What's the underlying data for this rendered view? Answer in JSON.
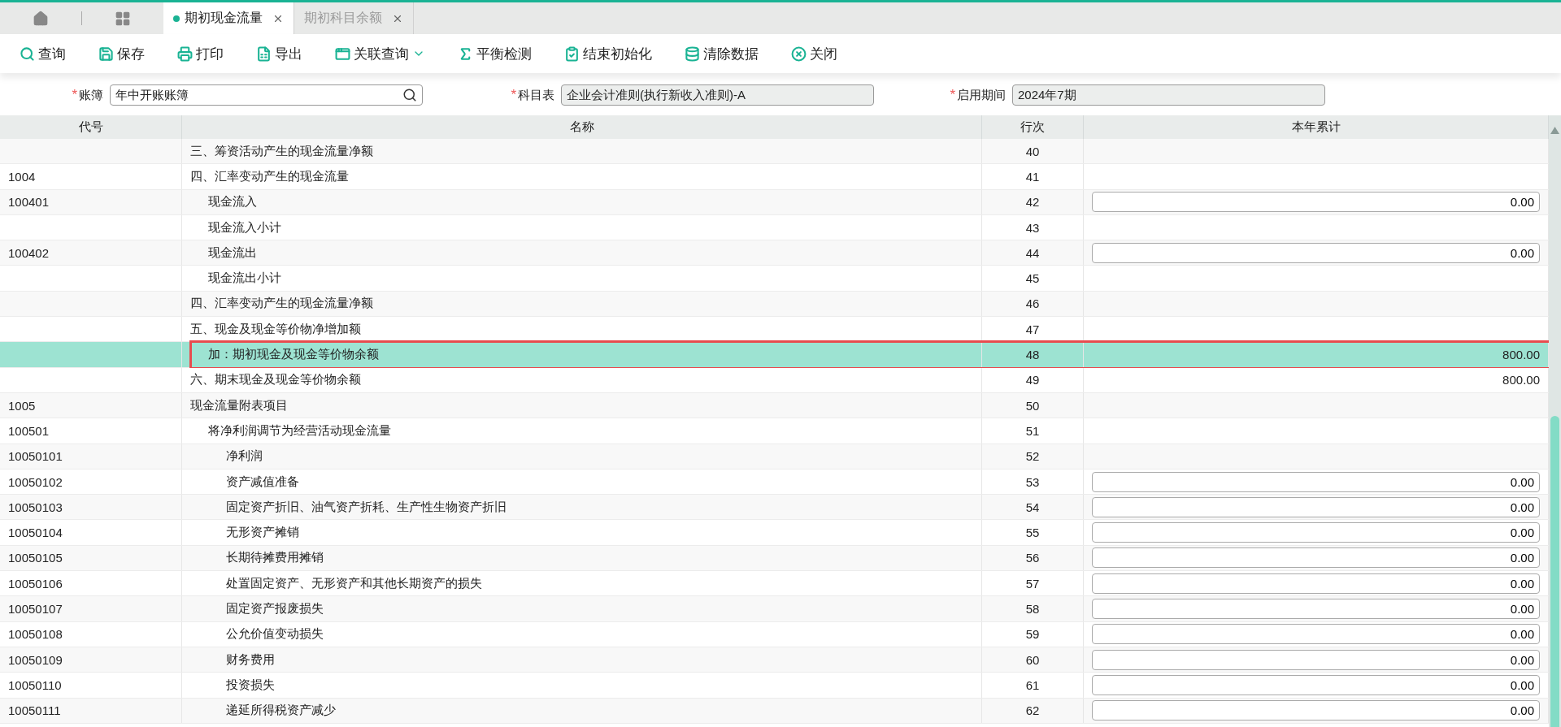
{
  "tabs": [
    {
      "label": "期初现金流量",
      "selected": true
    },
    {
      "label": "期初科目余额",
      "selected": false
    }
  ],
  "toolbar": [
    {
      "label": "查询",
      "kind": "button"
    },
    {
      "label": "保存",
      "kind": "button"
    },
    {
      "label": "打印",
      "kind": "button"
    },
    {
      "label": "导出",
      "kind": "button"
    },
    {
      "label": "关联查询",
      "kind": "menu"
    },
    {
      "label": "平衡检测",
      "kind": "button"
    },
    {
      "label": "结束初始化",
      "kind": "button"
    },
    {
      "label": "清除数据",
      "kind": "button"
    },
    {
      "label": "关闭",
      "kind": "button"
    }
  ],
  "filters": [
    {
      "mark": "*",
      "label": "账簿",
      "value": "年中开账账簿",
      "disabled": false
    },
    {
      "mark": "*",
      "label": "科目表",
      "value": "企业会计准则(执行新收入准则)-A",
      "disabled": true
    },
    {
      "mark": "*",
      "label": "启用期间",
      "value": "2024年7期",
      "disabled": true
    }
  ],
  "table": {
    "columns": [
      "代号",
      "名称",
      "行次",
      "本年累计"
    ],
    "rows": [
      {
        "name": "三、筹资活动产生的现金流量净额",
        "line": "40",
        "kind": "none",
        "selected": false
      },
      {
        "code": "1004",
        "name": "四、汇率变动产生的现金流量",
        "line": "41",
        "kind": "none",
        "selected": false,
        "children": [
          {
            "code": "100401",
            "name": "现金流入",
            "line": "42",
            "kind": "input",
            "value": "0.00",
            "selected": false
          },
          {
            "name": "现金流入小计",
            "line": "43",
            "kind": "none",
            "selected": false
          },
          {
            "code": "100402",
            "name": "现金流出",
            "line": "44",
            "kind": "input",
            "value": "0.00",
            "selected": false
          },
          {
            "name": "现金流出小计",
            "line": "45",
            "kind": "none",
            "selected": false
          }
        ]
      },
      {
        "name": "四、汇率变动产生的现金流量净额",
        "line": "46",
        "kind": "none",
        "selected": false
      },
      {
        "name": "五、现金及现金等价物净增加额",
        "line": "47",
        "kind": "none",
        "selected": false,
        "children": [
          {
            "name": "加：期初现金及现金等价物余额",
            "line": "48",
            "kind": "text",
            "value": "800.00",
            "selected": true
          }
        ]
      },
      {
        "name": "六、期末现金及现金等价物余额",
        "line": "49",
        "kind": "text",
        "value": "800.00",
        "selected": false
      },
      {
        "code": "1005",
        "name": "现金流量附表项目",
        "line": "50",
        "kind": "none",
        "selected": false,
        "children": [
          {
            "code": "100501",
            "name": "将净利润调节为经营活动现金流量",
            "line": "51",
            "kind": "none",
            "selected": false,
            "children": [
              {
                "code": "10050101",
                "name": "净利润",
                "line": "52",
                "kind": "none",
                "selected": false
              },
              {
                "code": "10050102",
                "name": "资产减值准备",
                "line": "53",
                "kind": "input",
                "value": "0.00",
                "selected": false
              },
              {
                "code": "10050103",
                "name": "固定资产折旧、油气资产折耗、生产性生物资产折旧",
                "line": "54",
                "kind": "input",
                "value": "0.00",
                "selected": false
              },
              {
                "code": "10050104",
                "name": "无形资产摊销",
                "line": "55",
                "kind": "input",
                "value": "0.00",
                "selected": false
              },
              {
                "code": "10050105",
                "name": "长期待摊费用摊销",
                "line": "56",
                "kind": "input",
                "value": "0.00",
                "selected": false
              },
              {
                "code": "10050106",
                "name": "处置固定资产、无形资产和其他长期资产的损失",
                "line": "57",
                "kind": "input",
                "value": "0.00",
                "selected": false
              },
              {
                "code": "10050107",
                "name": "固定资产报废损失",
                "line": "58",
                "kind": "input",
                "value": "0.00",
                "selected": false
              },
              {
                "code": "10050108",
                "name": "公允价值变动损失",
                "line": "59",
                "kind": "input",
                "value": "0.00",
                "selected": false
              },
              {
                "code": "10050109",
                "name": "财务费用",
                "line": "60",
                "kind": "input",
                "value": "0.00",
                "selected": false
              },
              {
                "code": "10050110",
                "name": "投资损失",
                "line": "61",
                "kind": "input",
                "value": "0.00",
                "selected": false
              },
              {
                "code": "10050111",
                "name": "递延所得税资产减少",
                "line": "62",
                "kind": "input",
                "value": "0.00",
                "selected": false
              }
            ]
          }
        ]
      }
    ]
  }
}
